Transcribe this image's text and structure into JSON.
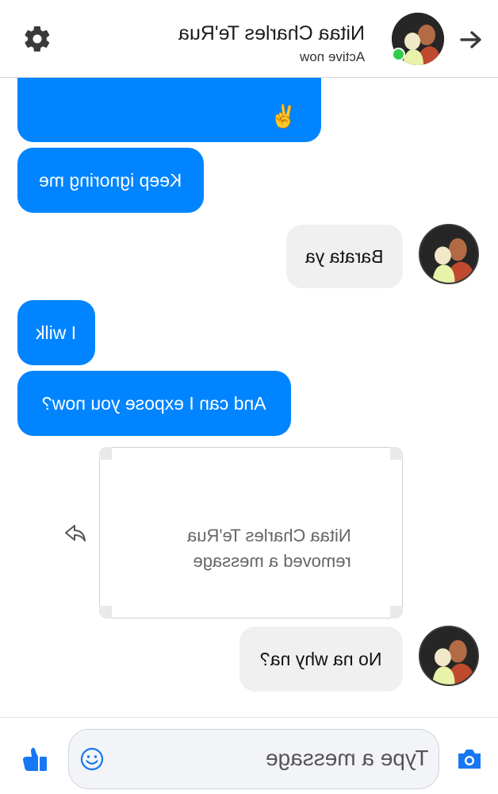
{
  "header": {
    "contact_name": "Nitaa Charles Te'Rua",
    "status": "Active now",
    "icons": {
      "settings": "gear-icon",
      "forward": "arrow-right-icon"
    }
  },
  "messages": [
    {
      "side": "left",
      "style": "blue",
      "text": "✌️",
      "truncated": true
    },
    {
      "side": "left",
      "style": "blue",
      "text": "Keep ignoring me"
    },
    {
      "side": "right",
      "style": "grey",
      "text": "Barata ya"
    },
    {
      "side": "left",
      "style": "blue",
      "text": "I wilk"
    },
    {
      "side": "left",
      "style": "blue",
      "text": "And can I expose you now?"
    },
    {
      "side": "right",
      "style": "removed",
      "line1": "Nitaa Charles Te'Rua",
      "line2": "removed a message"
    },
    {
      "side": "right",
      "style": "grey",
      "text": "No na why na?"
    }
  ],
  "composer": {
    "placeholder": "Type a message",
    "icons": {
      "like": "thumbs-up-icon",
      "emoji": "smiley-icon",
      "camera": "camera-icon"
    }
  },
  "colors": {
    "accent": "#0084ff",
    "grey_bubble": "#f1f0f0",
    "online": "#31cc46"
  }
}
